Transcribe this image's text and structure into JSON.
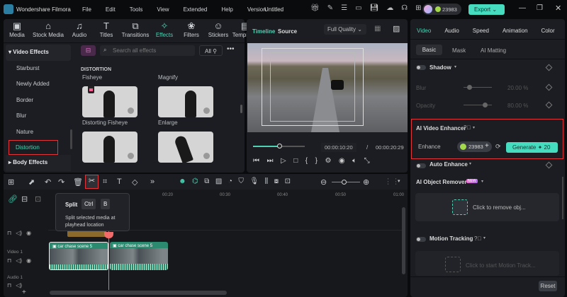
{
  "app": {
    "name": "Wondershare Filmora",
    "doc_title": "Untitled",
    "menu": [
      "File",
      "Edit",
      "Tools",
      "View",
      "Extended",
      "Help",
      "Version"
    ],
    "credits": "23983",
    "export_label": "Export"
  },
  "toolbar": [
    {
      "label": "Media",
      "icon": "▣"
    },
    {
      "label": "Stock Media",
      "icon": "⌂"
    },
    {
      "label": "Audio",
      "icon": "♫"
    },
    {
      "label": "Titles",
      "icon": "T"
    },
    {
      "label": "Transitions",
      "icon": "⧉"
    },
    {
      "label": "Effects",
      "icon": "✧"
    },
    {
      "label": "Filters",
      "icon": "❀"
    },
    {
      "label": "Stickers",
      "icon": "☺"
    },
    {
      "label": "Templates",
      "icon": "▤"
    }
  ],
  "sidebar": {
    "section": "Video Effects",
    "items": [
      "Starburst",
      "Newly Added",
      "Border",
      "Blur",
      "Nature",
      "Distortion"
    ],
    "selected": "Distortion",
    "next_section": "Body Effects"
  },
  "effects": {
    "search_placeholder": "Search all effects",
    "filter": "All",
    "category": "DISTORTION",
    "items": [
      "Fisheye",
      "Magnify",
      "Distorting Fisheye",
      "Enlarge"
    ]
  },
  "preview": {
    "tabs": [
      "Timeline",
      "Source"
    ],
    "quality": "Full Quality",
    "current_time": "00:00:10:20",
    "separator": "/",
    "total_time": "00:00:20:29",
    "progress": 0.5
  },
  "inspector": {
    "tabs": [
      "Video",
      "Audio",
      "Speed",
      "Animation",
      "Color"
    ],
    "subtabs": [
      "Basic",
      "Mask",
      "AI Matting"
    ],
    "shadow": {
      "label": "Shadow",
      "blur_label": "Blur",
      "blur_value": "20.00 %",
      "blur": 0.2,
      "opacity_label": "Opacity",
      "opacity_value": "80.00 %",
      "opacity": 0.8
    },
    "enhancer": {
      "title": "AI Video Enhancer",
      "enhance_label": "Enhance",
      "credits": "23983",
      "generate_label": "Generate",
      "cost": "20"
    },
    "auto_enhance": "Auto Enhance",
    "object_remover": {
      "title": "AI Object Remover",
      "badge": "NEW",
      "action": "Click to remove obj..."
    },
    "motion_tracking": {
      "title": "Motion Tracking",
      "action": "Click to start Motion Track..."
    },
    "reset_label": "Reset"
  },
  "timeline": {
    "ruler": [
      "00:20",
      "00:30",
      "00:40",
      "00:50",
      "01:00"
    ],
    "tooltip": {
      "title": "Split",
      "key1": "Ctrl",
      "key2": "B",
      "desc": "Split selected media at playhead location"
    },
    "tracks": [
      {
        "name": "Video 1"
      },
      {
        "name": "Audio 1"
      }
    ],
    "clips": [
      "car chase scene 5",
      "car chase scene 5"
    ]
  },
  "colors": {
    "accent": "#4fd1b4",
    "highlight": "#e0343a"
  }
}
